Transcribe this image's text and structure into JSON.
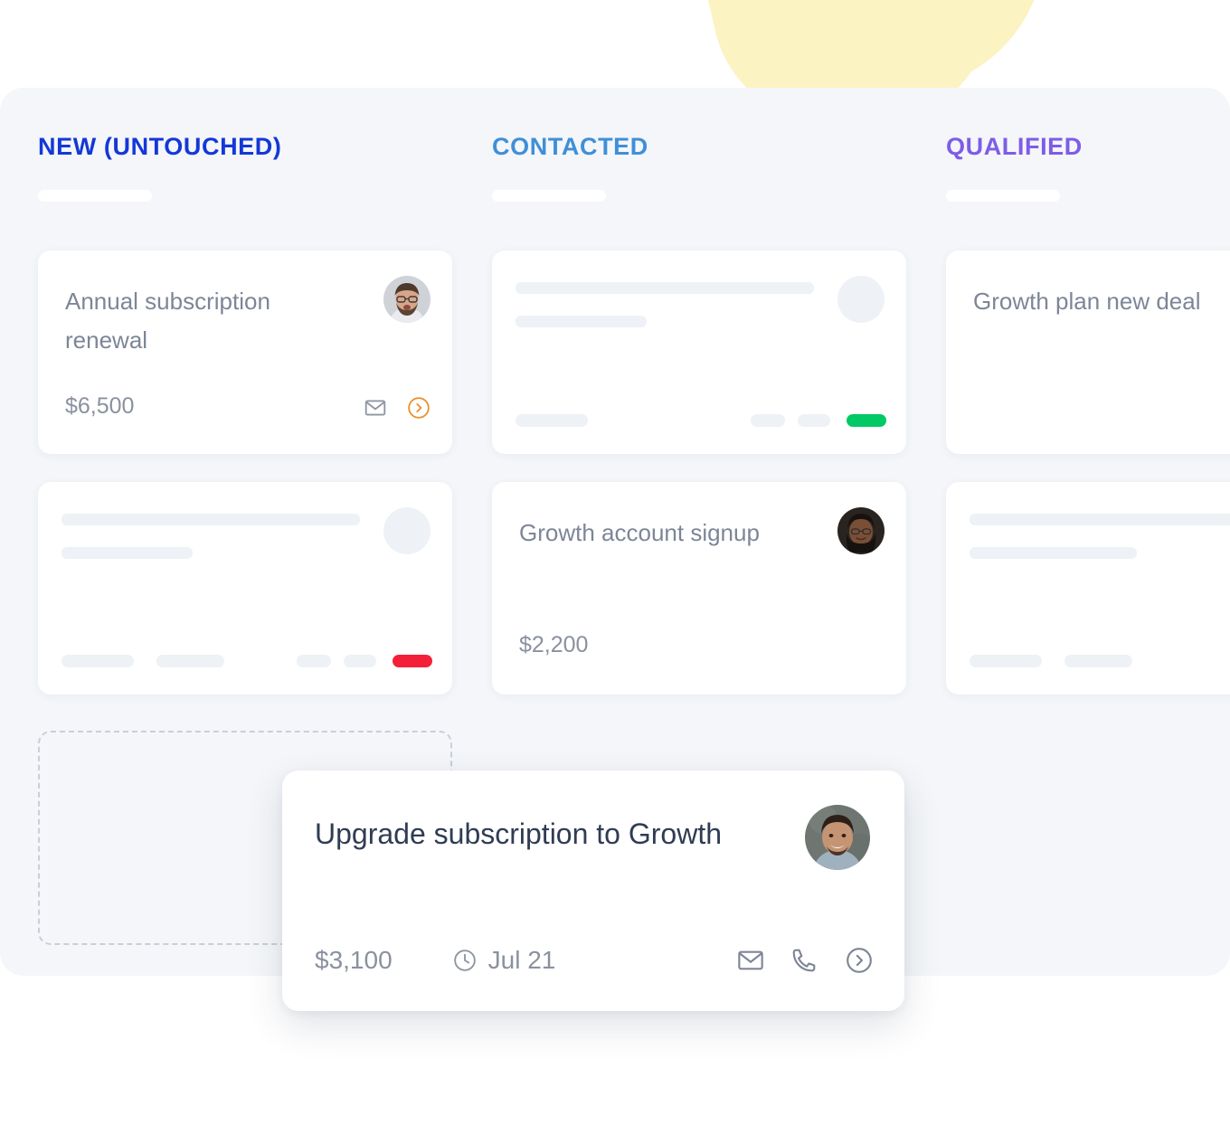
{
  "board": {
    "background_color": "#f4f6f9",
    "decor_shape_color": "#fcf3c2"
  },
  "columns": [
    {
      "id": "new-untouched",
      "title": "NEW (UNTOUCHED)",
      "title_color": "#1338d8",
      "cards": [
        {
          "type": "content",
          "title": "Annual subscription renewal",
          "amount": "$6,500",
          "avatar": "avatar-bearded-man-glasses",
          "actions": [
            "mail-icon",
            "chevron-right-circle-icon"
          ],
          "action_accent_color": "#e8922c"
        },
        {
          "type": "skeleton",
          "status_color": "#f4203a",
          "footer_left_pills": 2,
          "footer_right_pills": 2
        },
        {
          "type": "dropzone"
        }
      ]
    },
    {
      "id": "contacted",
      "title": "CONTACTED",
      "title_color": "#3f8fd8",
      "cards": [
        {
          "type": "skeleton",
          "status_color": "#00c965",
          "footer_left_pills": 1,
          "footer_right_pills": 2
        },
        {
          "type": "content",
          "title": "Growth account signup",
          "amount": "$2,200",
          "avatar": "avatar-woman-glasses",
          "actions": []
        }
      ]
    },
    {
      "id": "qualified",
      "title": "QUALIFIED",
      "title_color": "#7e5ce8",
      "cards": [
        {
          "type": "content",
          "title": "Growth plan new deal",
          "amount": "",
          "avatar": "",
          "actions": []
        },
        {
          "type": "skeleton",
          "status_color": "",
          "footer_left_pills": 2,
          "footer_right_pills": 1
        }
      ]
    }
  ],
  "floating_card": {
    "title": "Upgrade subscription to Growth",
    "amount": "$3,100",
    "date": "Jul 21",
    "date_icon": "clock-icon",
    "avatar": "avatar-smiling-man",
    "actions": [
      "mail-icon",
      "phone-icon",
      "chevron-right-circle-icon"
    ]
  }
}
